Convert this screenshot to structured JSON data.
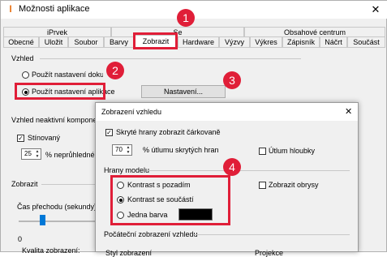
{
  "window": {
    "title": "Možnosti aplikace",
    "close_glyph": "✕"
  },
  "tabs": {
    "row1": [
      "iPrvek",
      "Se",
      "Obsahové centrum"
    ],
    "row2": [
      "Obecné",
      "Uložit",
      "Soubor",
      "Barvy",
      "Zobrazit",
      "Hardware",
      "Výzvy",
      "Výkres",
      "Zápisník",
      "Náčrt",
      "Součást"
    ],
    "active": "Zobrazit"
  },
  "vzhled": {
    "section_label": "Vzhled",
    "radio_document": "Použít nastavení dokume",
    "radio_app": "Použít nastavení aplikace",
    "settings_button": "Nastavení..."
  },
  "inactive": {
    "section_label": "Vzhled neaktivní komponenty",
    "shaded_label": "Stínovaný",
    "opacity_value": "25",
    "opacity_label": "% neprůhledné"
  },
  "display": {
    "section_label": "Zobrazit",
    "transition_label": "Čas přechodu (sekundy)",
    "slider_min": "0",
    "quality_label": "Kvalita zobrazení:",
    "slider_value_fraction": 0.3
  },
  "dialog": {
    "title": "Zobrazení vzhledu",
    "close_glyph": "✕",
    "dashed_hidden_label": "Skryté hrany zobrazit čárkovaně",
    "dimming_value": "70",
    "dimming_label": "% útlumu skrytých hran",
    "depth_dimming_label": "Útlum hloubky",
    "edges_section": "Hrany modelu",
    "edge_options": [
      "Kontrast s pozadím",
      "Kontrast se součástí",
      "Jedna barva"
    ],
    "edge_selected": "Kontrast se součástí",
    "show_outlines_label": "Zobrazit obrysy",
    "single_color_swatch": "#000000",
    "initial_section": "Počáteční zobrazení vzhledu",
    "bottom_left_label": "Styl zobrazení",
    "bottom_right_label": "Projekce"
  },
  "callouts": [
    "1",
    "2",
    "3",
    "4"
  ],
  "colors": {
    "callout": "#e01e38",
    "app_icon": "#e8741a"
  },
  "icons": [
    "app-icon",
    "close-icon",
    "checkmark-icon",
    "spin-arrows-icon"
  ]
}
